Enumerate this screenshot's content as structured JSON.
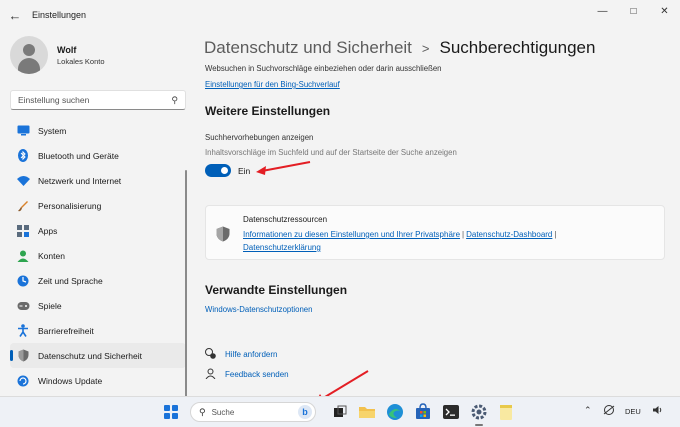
{
  "window": {
    "title": "Einstellungen",
    "back_icon": "arrow-left-icon",
    "controls": [
      "minimize-icon",
      "maximize-icon",
      "close-icon"
    ]
  },
  "profile": {
    "name": "Wolf",
    "account_type": "Lokales Konto"
  },
  "search": {
    "placeholder": "Einstellung suchen"
  },
  "sidebar": {
    "items": [
      {
        "label": "System",
        "icon": "monitor-icon",
        "color": "#1a73d9"
      },
      {
        "label": "Bluetooth und Geräte",
        "icon": "bluetooth-icon",
        "color": "#1a73d9"
      },
      {
        "label": "Netzwerk und Internet",
        "icon": "wifi-icon",
        "color": "#1a73d9"
      },
      {
        "label": "Personalisierung",
        "icon": "brush-icon",
        "color": "#d9822b"
      },
      {
        "label": "Apps",
        "icon": "apps-icon",
        "color": "#5a6b7d"
      },
      {
        "label": "Konten",
        "icon": "person-icon",
        "color": "#2ea44f"
      },
      {
        "label": "Zeit und Sprache",
        "icon": "globe-clock-icon",
        "color": "#1a73d9"
      },
      {
        "label": "Spiele",
        "icon": "gamepad-icon",
        "color": "#6b6b6b"
      },
      {
        "label": "Barrierefreiheit",
        "icon": "accessibility-icon",
        "color": "#1a73d9"
      },
      {
        "label": "Datenschutz und Sicherheit",
        "icon": "shield-icon",
        "color": "#6b6b6b",
        "active": true
      },
      {
        "label": "Windows Update",
        "icon": "update-icon",
        "color": "#1a73d9"
      }
    ]
  },
  "breadcrumb": {
    "parent": "Datenschutz und Sicherheit",
    "separator": ">",
    "current": "Suchberechtigungen"
  },
  "main": {
    "partial_text": "Websuchen in Suchvorschläge einbeziehen oder darin ausschließen",
    "bing_link": "Einstellungen für den Bing-Suchverlauf",
    "more_settings_heading": "Weitere Einstellungen",
    "highlights_title": "Suchhervorhebungen anzeigen",
    "highlights_desc": "Inhaltsvorschläge im Suchfeld und auf der Startseite der Suche anzeigen",
    "toggle_state": "Ein",
    "toggle_on": true,
    "resources_card": {
      "title": "Datenschutzressourcen",
      "links": [
        "Informationen zu diesen Einstellungen und Ihrer Privatsphäre",
        "Datenschutz-Dashboard",
        "Datenschutzerklärung"
      ],
      "separator": "|"
    },
    "related_heading": "Verwandte Einstellungen",
    "related_link": "Windows-Datenschutzoptionen",
    "help": [
      {
        "label": "Hilfe anfordern",
        "icon": "help-icon"
      },
      {
        "label": "Feedback senden",
        "icon": "feedback-icon"
      }
    ]
  },
  "taskbar": {
    "search_placeholder": "Suche",
    "language": "DEU",
    "tray_icons": [
      "chevron-up-icon",
      "network-icon",
      "volume-icon"
    ]
  },
  "colors": {
    "accent": "#005fb8",
    "annotation_arrow": "#e31e24"
  }
}
